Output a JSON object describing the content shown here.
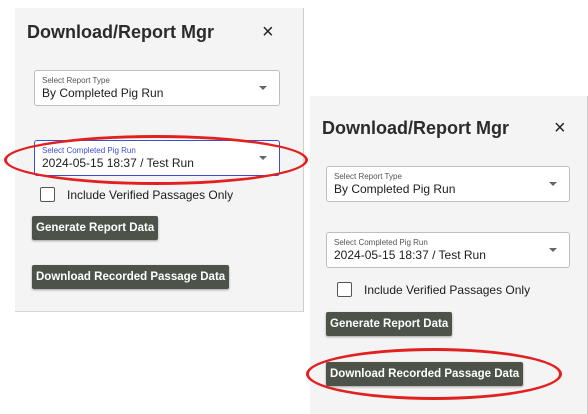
{
  "colors": {
    "panel_bg": "#f4f4f4",
    "button_bg": "#4d5348",
    "button_text": "#ffffff",
    "focus_accent": "#3b4fd1",
    "annotation_red": "#e32020"
  },
  "left_panel": {
    "title": "Download/Report Mgr",
    "close_icon": "×",
    "report_type": {
      "label": "Select Report Type",
      "value": "By Completed Pig Run"
    },
    "pig_run": {
      "label": "Select Completed Pig Run",
      "value": "2024-05-15 18:37 / Test Run"
    },
    "verified_only": {
      "label": "Include Verified Passages Only"
    },
    "generate_button": "Generate Report Data",
    "download_button": "Download Recorded Passage Data"
  },
  "right_panel": {
    "title": "Download/Report Mgr",
    "close_icon": "×",
    "report_type": {
      "label": "Select Report Type",
      "value": "By Completed Pig Run"
    },
    "pig_run": {
      "label": "Select Completed Pig Run",
      "value": "2024-05-15 18:37 / Test Run"
    },
    "verified_only": {
      "label": "Include Verified Passages Only"
    },
    "generate_button": "Generate Report Data",
    "download_button": "Download Recorded Passage Data"
  }
}
